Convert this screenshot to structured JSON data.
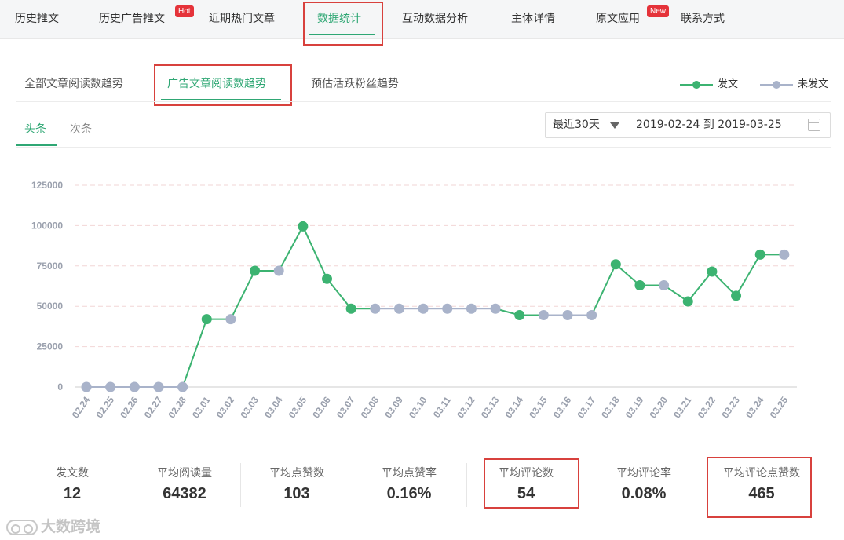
{
  "topnav": {
    "items": [
      {
        "label": "历史推文"
      },
      {
        "label": "历史广告推文",
        "badge": "Hot"
      },
      {
        "label": "近期热门文章"
      },
      {
        "label": "数据统计"
      },
      {
        "label": "互动数据分析"
      },
      {
        "label": "主体详情"
      },
      {
        "label": "原文应用",
        "badge": "New"
      },
      {
        "label": "联系方式"
      }
    ],
    "active": "数据统计"
  },
  "subtabs": {
    "items": [
      {
        "label": "全部文章阅读数趋势"
      },
      {
        "label": "广告文章阅读数趋势"
      },
      {
        "label": "预估活跃粉丝趋势"
      }
    ],
    "active": "广告文章阅读数趋势"
  },
  "legend": {
    "published": {
      "label": "发文",
      "color": "#3cb371"
    },
    "unpublished": {
      "label": "未发文",
      "color": "#a9b3ca"
    }
  },
  "toutiao_tabs": {
    "items": [
      {
        "label": "头条"
      },
      {
        "label": "次条"
      }
    ],
    "active": "头条"
  },
  "date_filter": {
    "range_label": "最近30天",
    "start": "2019-02-24",
    "separator": "到",
    "end": "2019-03-25"
  },
  "chart_data": {
    "type": "line",
    "categories": [
      "02.24",
      "02.25",
      "02.26",
      "02.27",
      "02.28",
      "03.01",
      "03.02",
      "03.03",
      "03.04",
      "03.05",
      "03.06",
      "03.07",
      "03.08",
      "03.09",
      "03.10",
      "03.11",
      "03.12",
      "03.13",
      "03.14",
      "03.15",
      "03.16",
      "03.17",
      "03.18",
      "03.19",
      "03.20",
      "03.21",
      "03.22",
      "03.23",
      "03.24",
      "03.25"
    ],
    "values": [
      0,
      0,
      0,
      0,
      0,
      42000,
      42000,
      72000,
      72000,
      99500,
      67000,
      48500,
      48500,
      48500,
      48500,
      48500,
      48500,
      48500,
      44500,
      44500,
      44500,
      44500,
      76000,
      63000,
      63000,
      53000,
      71500,
      56500,
      82000,
      82000
    ],
    "published": [
      false,
      false,
      false,
      false,
      false,
      true,
      false,
      true,
      false,
      true,
      true,
      true,
      false,
      false,
      false,
      false,
      false,
      false,
      true,
      false,
      false,
      false,
      true,
      true,
      false,
      true,
      true,
      true,
      true,
      false
    ],
    "yticks": [
      0,
      25000,
      50000,
      75000,
      100000,
      125000
    ],
    "ylim": [
      0,
      125000
    ],
    "grid": true,
    "colors": {
      "published": "#3cb371",
      "unpublished": "#a9b3ca"
    }
  },
  "stats": [
    {
      "label": "发文数",
      "value": "12"
    },
    {
      "label": "平均阅读量",
      "value": "64382"
    },
    {
      "label": "平均点赞数",
      "value": "103"
    },
    {
      "label": "平均点赞率",
      "value": "0.16%"
    },
    {
      "label": "平均评论数",
      "value": "54"
    },
    {
      "label": "平均评论率",
      "value": "0.08%"
    },
    {
      "label": "平均评论点赞数",
      "value": "465"
    }
  ],
  "watermark": {
    "text": "大数跨境"
  }
}
